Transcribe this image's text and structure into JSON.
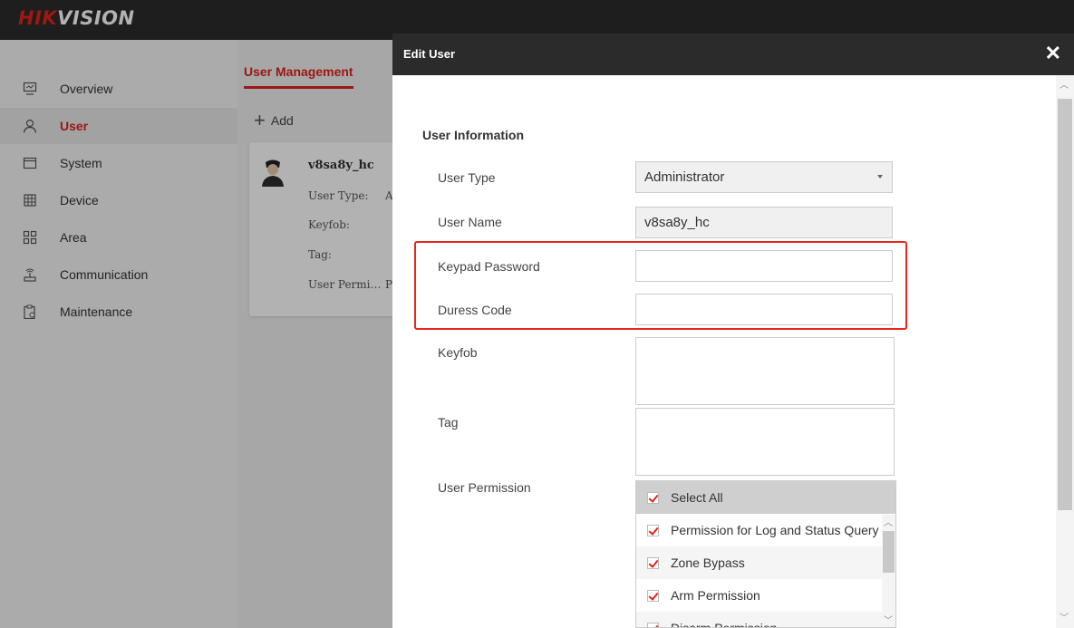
{
  "app": {
    "logo_part1": "HIK",
    "logo_part2": "VISION"
  },
  "sidebar": {
    "items": [
      {
        "label": "Overview",
        "icon": "monitor-icon"
      },
      {
        "label": "User",
        "icon": "user-icon",
        "active": true
      },
      {
        "label": "System",
        "icon": "window-icon"
      },
      {
        "label": "Device",
        "icon": "device-icon"
      },
      {
        "label": "Area",
        "icon": "grid-icon"
      },
      {
        "label": "Communication",
        "icon": "antenna-icon"
      },
      {
        "label": "Maintenance",
        "icon": "clipboard-gear-icon"
      }
    ]
  },
  "main": {
    "tab": "User Management",
    "add_label": "Add",
    "card": {
      "name": "v8sa8y_hc",
      "fields": [
        "User Type:",
        "Keyfob:",
        "Tag:",
        "User Permi…"
      ],
      "values": [
        "A",
        "",
        "",
        "P"
      ]
    }
  },
  "dialog": {
    "title": "Edit User",
    "close": "✕",
    "section": "User Information",
    "labels": {
      "user_type": "User Type",
      "user_name": "User Name",
      "keypad_password": "Keypad Password",
      "duress_code": "Duress Code",
      "keyfob": "Keyfob",
      "tag": "Tag",
      "user_permission": "User Permission"
    },
    "values": {
      "user_type": "Administrator",
      "user_name": "v8sa8y_hc",
      "keypad_password": "",
      "duress_code": ""
    },
    "permissions": {
      "select_all": "Select All",
      "items": [
        "Permission for Log and Status Query",
        "Zone Bypass",
        "Arm Permission",
        "Disarm Permission"
      ]
    }
  },
  "colors": {
    "accent": "#e0231b",
    "topbar": "#2b2b2b",
    "highlight": "#e8261d"
  }
}
